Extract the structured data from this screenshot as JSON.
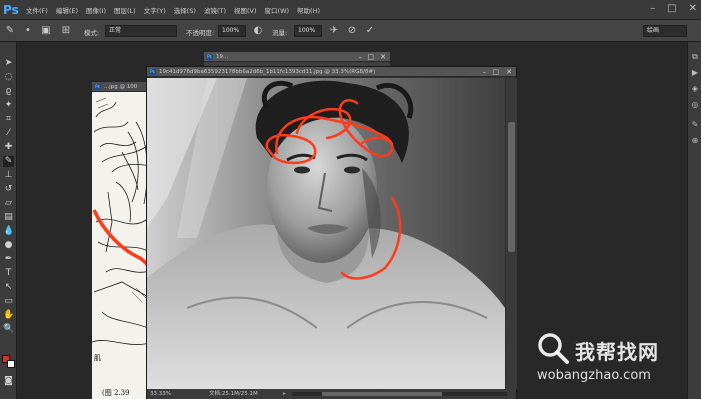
{
  "app": {
    "logo": "Ps"
  },
  "menu": [
    "文件(F)",
    "编辑(E)",
    "图像(I)",
    "图层(L)",
    "文字(Y)",
    "选择(S)",
    "滤镜(T)",
    "视图(V)",
    "窗口(W)",
    "帮助(H)"
  ],
  "options": {
    "mode_label": "模式:",
    "mode_value": "正常",
    "opacity_label": "不透明度:",
    "opacity_value": "100%",
    "flow_label": "流量:",
    "flow_value": "100%",
    "workspace": "绘画"
  },
  "documents": {
    "back_title": "19...",
    "left_title": "...jpg @ 100",
    "left_caption": "(图 2.39",
    "left_label": "肌",
    "main_title": "19c41d976d9ba635923178bb6a2d6b_1b11fc1393cd11.jpg @ 33.3%(RGB/8#)",
    "zoom": "33.33%",
    "doc_info": "文档:25.1M/25.1M"
  },
  "watermark": {
    "text": "我帮找网",
    "domain": "wobangzhao.com"
  },
  "colors": {
    "foreground": "#e0301c",
    "background": "#ffffff",
    "annotation": "#ff3b1a"
  }
}
